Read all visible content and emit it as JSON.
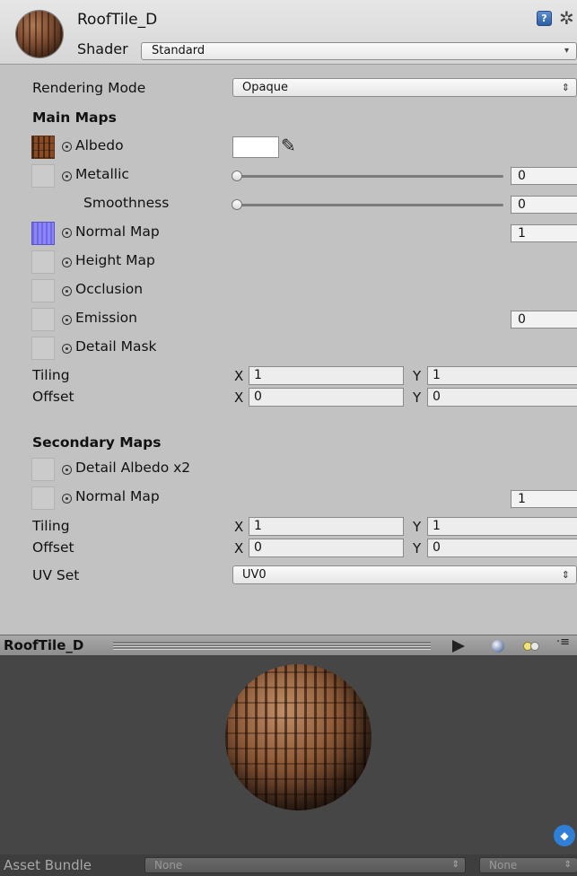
{
  "header": {
    "title": "RoofTile_D",
    "shader_label": "Shader",
    "shader_value": "Standard",
    "help_icon": "?"
  },
  "rendering_mode": {
    "label": "Rendering Mode",
    "value": "Opaque"
  },
  "main_maps": {
    "title": "Main Maps",
    "albedo": {
      "label": "Albedo",
      "color": "#ffffff"
    },
    "metallic": {
      "label": "Metallic",
      "value": "0",
      "level": 0
    },
    "smoothness": {
      "label": "Smoothness",
      "value": "0",
      "level": 0
    },
    "normal_map": {
      "label": "Normal Map",
      "value": "1"
    },
    "height_map": {
      "label": "Height Map"
    },
    "occlusion": {
      "label": "Occlusion"
    },
    "emission": {
      "label": "Emission",
      "value": "0"
    },
    "detail_mask": {
      "label": "Detail Mask"
    },
    "tiling": {
      "label": "Tiling",
      "x": "1",
      "y": "1"
    },
    "offset": {
      "label": "Offset",
      "x": "0",
      "y": "0"
    }
  },
  "secondary_maps": {
    "title": "Secondary Maps",
    "detail_albedo": {
      "label": "Detail Albedo x2"
    },
    "normal_map": {
      "label": "Normal Map",
      "value": "1"
    },
    "tiling": {
      "label": "Tiling",
      "x": "1",
      "y": "1"
    },
    "offset": {
      "label": "Offset",
      "x": "0",
      "y": "0"
    },
    "uv_set": {
      "label": "UV Set",
      "value": "UV0"
    }
  },
  "axis_labels": {
    "x": "X",
    "y": "Y"
  },
  "preview": {
    "title": "RoofTile_D"
  },
  "asset_bundle": {
    "label": "Asset Bundle",
    "name": "None",
    "variant": "None"
  },
  "icons": {
    "help": "help-book-icon",
    "settings": "gear-icon",
    "eyedropper": "eyedropper-icon",
    "play": "play-icon",
    "preview_shape": "sphere-icon",
    "lighting": "lights-icon",
    "menu": "menu-icon",
    "tag": "tag-icon"
  },
  "colors": {
    "panel_bg": "#c2c2c2",
    "preview_bg": "#464646",
    "accent": "#2f7fd6"
  }
}
